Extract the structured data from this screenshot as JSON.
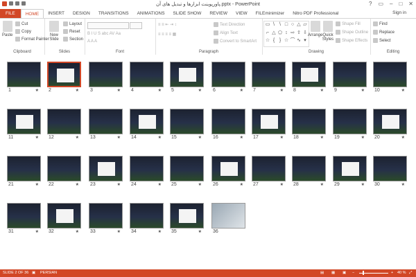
{
  "app": {
    "title": "پاورپوینت ابزارها و تبدیل های آن.pptx - PowerPoint",
    "signin": "Sign in"
  },
  "tabs": [
    "FILE",
    "HOME",
    "INSERT",
    "DESIGN",
    "TRANSITIONS",
    "ANIMATIONS",
    "SLIDE SHOW",
    "REVIEW",
    "VIEW",
    "FILEminimizer",
    "Nitro PDF Professional"
  ],
  "ribbon": {
    "clipboard": {
      "label": "Clipboard",
      "paste": "Paste",
      "cut": "Cut",
      "copy": "Copy",
      "format_painter": "Format Painter"
    },
    "slides": {
      "label": "Slides",
      "new_slide": "New Slide",
      "layout": "Layout",
      "reset": "Reset",
      "section": "Section"
    },
    "font": {
      "label": "Font"
    },
    "paragraph": {
      "label": "Paragraph",
      "text_direction": "Text Direction",
      "align_text": "Align Text",
      "convert": "Convert to SmartArt"
    },
    "drawing": {
      "label": "Drawing",
      "arrange": "Arrange",
      "quick_styles": "Quick Styles",
      "shape_fill": "Shape Fill",
      "shape_outline": "Shape Outline",
      "shape_effects": "Shape Effects"
    },
    "editing": {
      "label": "Editing",
      "find": "Find",
      "replace": "Replace",
      "select": "Select"
    }
  },
  "slides": [
    {
      "n": "1",
      "style": "dark"
    },
    {
      "n": "2",
      "style": "dark",
      "selected": true
    },
    {
      "n": "3",
      "style": "dark"
    },
    {
      "n": "4",
      "style": "dark"
    },
    {
      "n": "5",
      "style": "dark"
    },
    {
      "n": "6",
      "style": "dark"
    },
    {
      "n": "7",
      "style": "dark"
    },
    {
      "n": "8",
      "style": "dark"
    },
    {
      "n": "9",
      "style": "dark"
    },
    {
      "n": "10",
      "style": "dark"
    },
    {
      "n": "11",
      "style": "dark"
    },
    {
      "n": "12",
      "style": "dark"
    },
    {
      "n": "13",
      "style": "dark"
    },
    {
      "n": "14",
      "style": "dark"
    },
    {
      "n": "15",
      "style": "dark"
    },
    {
      "n": "16",
      "style": "dark"
    },
    {
      "n": "17",
      "style": "dark"
    },
    {
      "n": "18",
      "style": "dark"
    },
    {
      "n": "19",
      "style": "dark"
    },
    {
      "n": "20",
      "style": "dark"
    },
    {
      "n": "21",
      "style": "dark"
    },
    {
      "n": "22",
      "style": "dark"
    },
    {
      "n": "23",
      "style": "dark"
    },
    {
      "n": "24",
      "style": "dark"
    },
    {
      "n": "25",
      "style": "dark"
    },
    {
      "n": "26",
      "style": "dark"
    },
    {
      "n": "27",
      "style": "dark"
    },
    {
      "n": "28",
      "style": "dark"
    },
    {
      "n": "29",
      "style": "dark"
    },
    {
      "n": "30",
      "style": "dark"
    },
    {
      "n": "31",
      "style": "dark"
    },
    {
      "n": "32",
      "style": "dark"
    },
    {
      "n": "33",
      "style": "dark"
    },
    {
      "n": "34",
      "style": "dark"
    },
    {
      "n": "35",
      "style": "dark"
    },
    {
      "n": "36",
      "style": "photo"
    }
  ],
  "status": {
    "slide": "SLIDE 2 OF 36",
    "language": "PERSIAN",
    "zoom": "40 %",
    "zoom_level": 0.4
  },
  "colors": {
    "accent": "#d24726"
  }
}
